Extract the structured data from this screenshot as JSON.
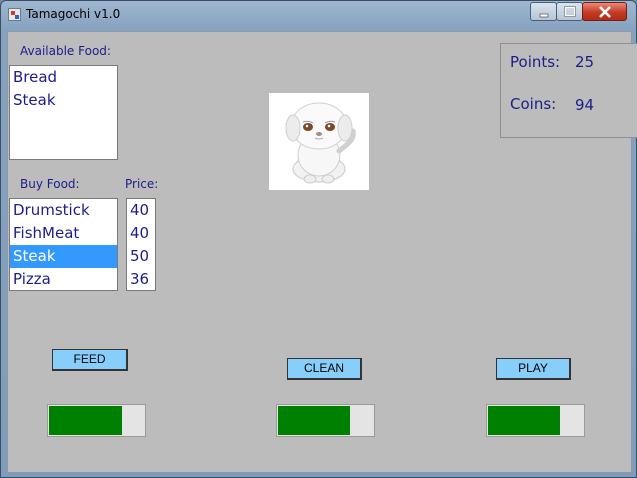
{
  "window": {
    "title": "Tamagochi v1.0"
  },
  "available_food": {
    "label": "Available Food:",
    "items": [
      "Bread",
      "Steak"
    ]
  },
  "buy_food": {
    "label": "Buy Food:",
    "items": [
      "Drumstick",
      "FishMeat",
      "Steak",
      "Pizza"
    ],
    "selected": "Steak"
  },
  "price": {
    "label": "Price:",
    "items": [
      "40",
      "40",
      "50",
      "36"
    ]
  },
  "stats": {
    "points_label": "Points:",
    "points_value": "25",
    "coins_label": "Coins:",
    "coins_value": "94"
  },
  "pet": {
    "icon": "puppy-icon"
  },
  "buttons": {
    "feed": "FEED",
    "clean": "CLEAN",
    "play": "PLAY"
  },
  "bars": {
    "feed_level": 0.75,
    "clean_level": 0.74,
    "play_level": 0.74
  },
  "colors": {
    "bar_fill": "#008000",
    "button_bg": "#87cefa",
    "text": "#1d1d8a",
    "selection": "#3399ff"
  }
}
